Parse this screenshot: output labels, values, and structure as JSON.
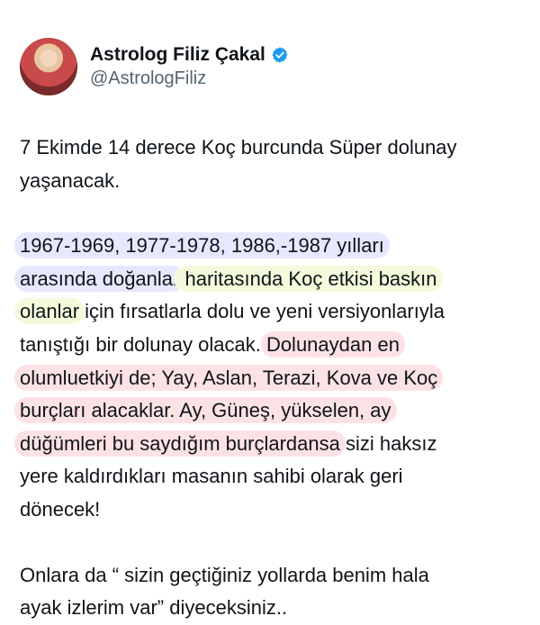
{
  "profile": {
    "name": "Astrolog Filiz Çakal",
    "handle": "@AstrologFiliz"
  },
  "tweet": {
    "intro": [
      "7 Ekimde 14 derece Koç burcunda Süper dolunay",
      "yaşanacak."
    ],
    "p2": {
      "l1a": "1967-1969, 1977-1978, 1986,-1987 yılları",
      "l2a": "arasında doğanlar",
      "l2b": " haritasında Koç etkisi baskın",
      "l3a": "olanlar",
      "l3b": " için fırsatlarla dolu ve yeni versiyonlarıyla",
      "l4a": "tanıştığı bir dolunay olacak. ",
      "l4b": "Dolunaydan en",
      "l5": "olumluetkiyi de; Yay, Aslan, Terazi, Kova ve Koç",
      "l6": "burçları alacaklar. Ay, Güneş, yükselen, ay",
      "l7a": "düğümleri bu saydığım burçlardansa",
      "l7b": " sizi haksız",
      "l8": "yere kaldırdıkları masanın sahibi olarak geri",
      "l9": "dönecek!"
    },
    "closing": [
      "Onlara da “ sizin geçtiğiniz yollarda benim hala",
      "ayak izlerim var” diyeceksiniz.."
    ]
  },
  "colors": {
    "highlight_blue": "#e7e8ff",
    "highlight_green": "#f4fbdc",
    "highlight_red": "#fde2e5",
    "verified": "#1d9bf0"
  },
  "icons": {
    "verified": "verified-badge-icon"
  }
}
